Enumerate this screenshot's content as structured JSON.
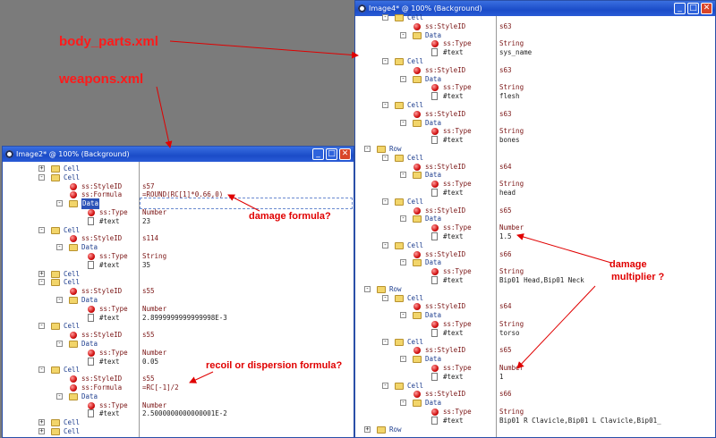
{
  "captions": {
    "body_parts": "body_parts.xml",
    "weapons": "weapons.xml"
  },
  "annotations": {
    "damage_formula": "damage formula?",
    "recoil": "recoil or dispersion formula?",
    "damage_multiplier_line1": "damage",
    "damage_multiplier_line2": "multiplier ?"
  },
  "colors": {
    "accent": "#1b4cc8",
    "annotation": "#e00000",
    "background": "#7b7b7b"
  },
  "left_window": {
    "title": "Image2* @ 100% (Background)",
    "rows": [
      {
        "kind": "node",
        "name": "Cell",
        "level": 1,
        "expander": "+",
        "value": ""
      },
      {
        "kind": "node",
        "name": "Cell",
        "level": 1,
        "expander": "-",
        "value": ""
      },
      {
        "kind": "attr",
        "name": "ss:StyleID",
        "level": 2,
        "value": "s57"
      },
      {
        "kind": "attr",
        "name": "ss:Formula",
        "level": 2,
        "value": "=ROUND(RC[1]*0.66,0)"
      },
      {
        "kind": "node",
        "name": "Data",
        "level": 2,
        "expander": "-",
        "value": "",
        "selected": true
      },
      {
        "kind": "attr",
        "name": "ss:Type",
        "level": 3,
        "value": "Number"
      },
      {
        "kind": "text",
        "name": "#text",
        "level": 3,
        "value": "23"
      },
      {
        "kind": "node",
        "name": "Cell",
        "level": 1,
        "expander": "-",
        "value": ""
      },
      {
        "kind": "attr",
        "name": "ss:StyleID",
        "level": 2,
        "value": "s114"
      },
      {
        "kind": "node",
        "name": "Data",
        "level": 2,
        "expander": "-",
        "value": ""
      },
      {
        "kind": "attr",
        "name": "ss:Type",
        "level": 3,
        "value": "String"
      },
      {
        "kind": "text",
        "name": "#text",
        "level": 3,
        "value": "35"
      },
      {
        "kind": "node",
        "name": "Cell",
        "level": 1,
        "expander": "+",
        "value": ""
      },
      {
        "kind": "node",
        "name": "Cell",
        "level": 1,
        "expander": "-",
        "value": ""
      },
      {
        "kind": "attr",
        "name": "ss:StyleID",
        "level": 2,
        "value": "s55"
      },
      {
        "kind": "node",
        "name": "Data",
        "level": 2,
        "expander": "-",
        "value": ""
      },
      {
        "kind": "attr",
        "name": "ss:Type",
        "level": 3,
        "value": "Number"
      },
      {
        "kind": "text",
        "name": "#text",
        "level": 3,
        "value": "2.8999999999999998E-3"
      },
      {
        "kind": "node",
        "name": "Cell",
        "level": 1,
        "expander": "-",
        "value": ""
      },
      {
        "kind": "attr",
        "name": "ss:StyleID",
        "level": 2,
        "value": "s55"
      },
      {
        "kind": "node",
        "name": "Data",
        "level": 2,
        "expander": "-",
        "value": ""
      },
      {
        "kind": "attr",
        "name": "ss:Type",
        "level": 3,
        "value": "Number"
      },
      {
        "kind": "text",
        "name": "#text",
        "level": 3,
        "value": "0.05"
      },
      {
        "kind": "node",
        "name": "Cell",
        "level": 1,
        "expander": "-",
        "value": ""
      },
      {
        "kind": "attr",
        "name": "ss:StyleID",
        "level": 2,
        "value": "s55"
      },
      {
        "kind": "attr",
        "name": "ss:Formula",
        "level": 2,
        "value": "=RC[-1]/2"
      },
      {
        "kind": "node",
        "name": "Data",
        "level": 2,
        "expander": "-",
        "value": ""
      },
      {
        "kind": "attr",
        "name": "ss:Type",
        "level": 3,
        "value": "Number"
      },
      {
        "kind": "text",
        "name": "#text",
        "level": 3,
        "value": "2.5000000000000001E-2"
      },
      {
        "kind": "node",
        "name": "Cell",
        "level": 1,
        "expander": "+",
        "value": ""
      },
      {
        "kind": "node",
        "name": "Cell",
        "level": 1,
        "expander": "+",
        "value": ""
      }
    ]
  },
  "right_window": {
    "title": "Image4* @ 100% (Background)",
    "rows": [
      {
        "kind": "node",
        "name": "Cell",
        "level": 1,
        "expander": "-",
        "value": ""
      },
      {
        "kind": "attr",
        "name": "ss:StyleID",
        "level": 2,
        "value": "s63"
      },
      {
        "kind": "node",
        "name": "Data",
        "level": 2,
        "expander": "-",
        "value": ""
      },
      {
        "kind": "attr",
        "name": "ss:Type",
        "level": 3,
        "value": "String"
      },
      {
        "kind": "text",
        "name": "#text",
        "level": 3,
        "value": "sys_name"
      },
      {
        "kind": "node",
        "name": "Cell",
        "level": 1,
        "expander": "-",
        "value": ""
      },
      {
        "kind": "attr",
        "name": "ss:StyleID",
        "level": 2,
        "value": "s63"
      },
      {
        "kind": "node",
        "name": "Data",
        "level": 2,
        "expander": "-",
        "value": ""
      },
      {
        "kind": "attr",
        "name": "ss:Type",
        "level": 3,
        "value": "String"
      },
      {
        "kind": "text",
        "name": "#text",
        "level": 3,
        "value": "flesh"
      },
      {
        "kind": "node",
        "name": "Cell",
        "level": 1,
        "expander": "-",
        "value": ""
      },
      {
        "kind": "attr",
        "name": "ss:StyleID",
        "level": 2,
        "value": "s63"
      },
      {
        "kind": "node",
        "name": "Data",
        "level": 2,
        "expander": "-",
        "value": ""
      },
      {
        "kind": "attr",
        "name": "ss:Type",
        "level": 3,
        "value": "String"
      },
      {
        "kind": "text",
        "name": "#text",
        "level": 3,
        "value": "bones"
      },
      {
        "kind": "node",
        "name": "Row",
        "level": 0,
        "expander": "-",
        "value": ""
      },
      {
        "kind": "node",
        "name": "Cell",
        "level": 1,
        "expander": "-",
        "value": ""
      },
      {
        "kind": "attr",
        "name": "ss:StyleID",
        "level": 2,
        "value": "s64"
      },
      {
        "kind": "node",
        "name": "Data",
        "level": 2,
        "expander": "-",
        "value": ""
      },
      {
        "kind": "attr",
        "name": "ss:Type",
        "level": 3,
        "value": "String"
      },
      {
        "kind": "text",
        "name": "#text",
        "level": 3,
        "value": "head"
      },
      {
        "kind": "node",
        "name": "Cell",
        "level": 1,
        "expander": "-",
        "value": ""
      },
      {
        "kind": "attr",
        "name": "ss:StyleID",
        "level": 2,
        "value": "s65"
      },
      {
        "kind": "node",
        "name": "Data",
        "level": 2,
        "expander": "-",
        "value": ""
      },
      {
        "kind": "attr",
        "name": "ss:Type",
        "level": 3,
        "value": "Number"
      },
      {
        "kind": "text",
        "name": "#text",
        "level": 3,
        "value": "1.5"
      },
      {
        "kind": "node",
        "name": "Cell",
        "level": 1,
        "expander": "-",
        "value": ""
      },
      {
        "kind": "attr",
        "name": "ss:StyleID",
        "level": 2,
        "value": "s66"
      },
      {
        "kind": "node",
        "name": "Data",
        "level": 2,
        "expander": "-",
        "value": ""
      },
      {
        "kind": "attr",
        "name": "ss:Type",
        "level": 3,
        "value": "String"
      },
      {
        "kind": "text",
        "name": "#text",
        "level": 3,
        "value": "Bip01 Head,Bip01 Neck"
      },
      {
        "kind": "node",
        "name": "Row",
        "level": 0,
        "expander": "-",
        "value": ""
      },
      {
        "kind": "node",
        "name": "Cell",
        "level": 1,
        "expander": "-",
        "value": ""
      },
      {
        "kind": "attr",
        "name": "ss:StyleID",
        "level": 2,
        "value": "s64"
      },
      {
        "kind": "node",
        "name": "Data",
        "level": 2,
        "expander": "-",
        "value": ""
      },
      {
        "kind": "attr",
        "name": "ss:Type",
        "level": 3,
        "value": "String"
      },
      {
        "kind": "text",
        "name": "#text",
        "level": 3,
        "value": "torso"
      },
      {
        "kind": "node",
        "name": "Cell",
        "level": 1,
        "expander": "-",
        "value": ""
      },
      {
        "kind": "attr",
        "name": "ss:StyleID",
        "level": 2,
        "value": "s65"
      },
      {
        "kind": "node",
        "name": "Data",
        "level": 2,
        "expander": "-",
        "value": ""
      },
      {
        "kind": "attr",
        "name": "ss:Type",
        "level": 3,
        "value": "Number"
      },
      {
        "kind": "text",
        "name": "#text",
        "level": 3,
        "value": "1"
      },
      {
        "kind": "node",
        "name": "Cell",
        "level": 1,
        "expander": "-",
        "value": ""
      },
      {
        "kind": "attr",
        "name": "ss:StyleID",
        "level": 2,
        "value": "s66"
      },
      {
        "kind": "node",
        "name": "Data",
        "level": 2,
        "expander": "-",
        "value": ""
      },
      {
        "kind": "attr",
        "name": "ss:Type",
        "level": 3,
        "value": "String"
      },
      {
        "kind": "text",
        "name": "#text",
        "level": 3,
        "value": "Bip01 R Clavicle,Bip01 L Clavicle,Bip01_"
      },
      {
        "kind": "node",
        "name": "Row",
        "level": 0,
        "expander": "+",
        "value": ""
      }
    ]
  }
}
